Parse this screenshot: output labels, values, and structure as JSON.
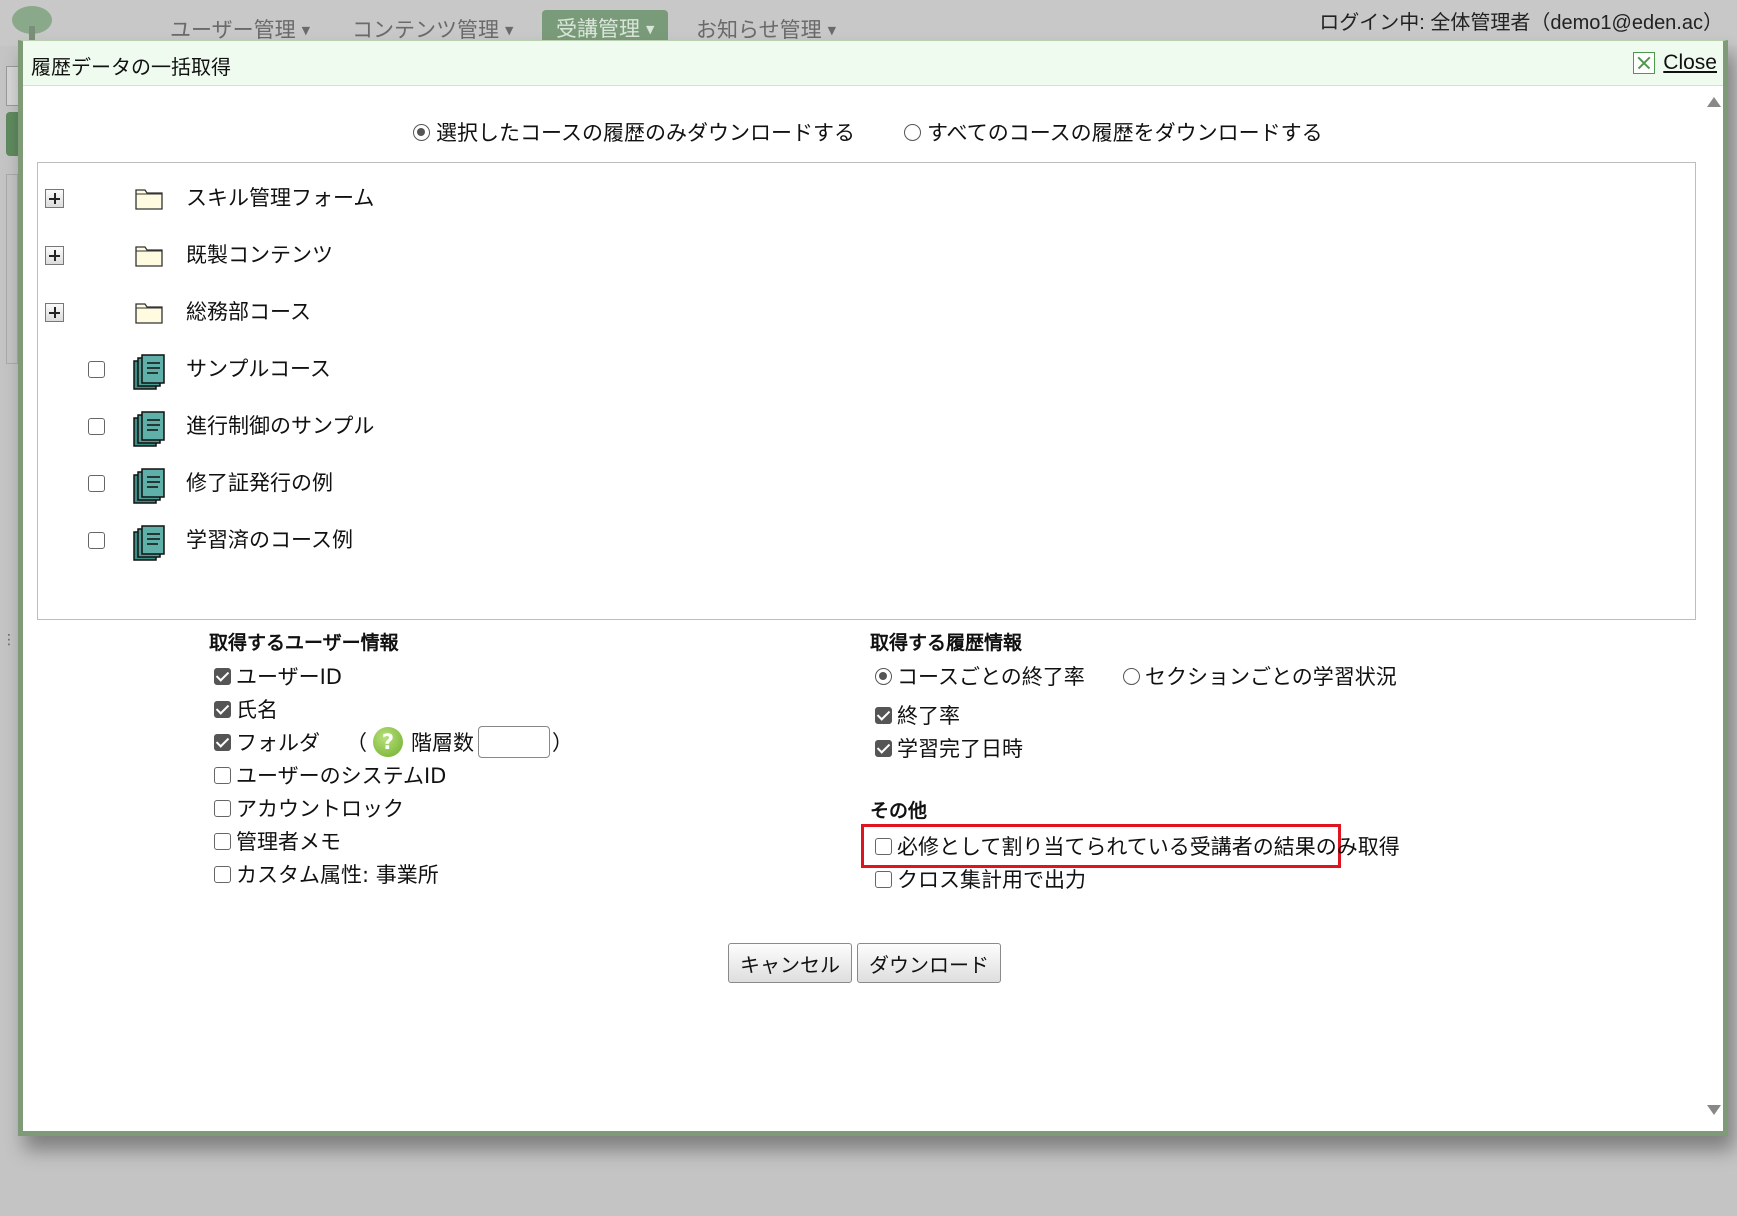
{
  "background": {
    "nav": [
      {
        "label": "ユーザー管理",
        "active": false
      },
      {
        "label": "コンテンツ管理",
        "active": false
      },
      {
        "label": "受講管理",
        "active": true
      },
      {
        "label": "お知らせ管理",
        "active": false
      }
    ],
    "login_text": "ログイン中: 全体管理者（demo1@eden.ac）"
  },
  "dialog": {
    "title": "履歴データの一括取得",
    "close_label": "Close",
    "scope_options": [
      {
        "label": "選択したコースの履歴のみダウンロードする",
        "selected": true
      },
      {
        "label": "すべてのコースの履歴をダウンロードする",
        "selected": false
      }
    ],
    "tree": [
      {
        "type": "folder",
        "label": "スキル管理フォーム"
      },
      {
        "type": "folder",
        "label": "既製コンテンツ"
      },
      {
        "type": "folder",
        "label": "総務部コース"
      },
      {
        "type": "course",
        "label": "サンプルコース",
        "checked": false
      },
      {
        "type": "course",
        "label": "進行制御のサンプル",
        "checked": false
      },
      {
        "type": "course",
        "label": "修了証発行の例",
        "checked": false
      },
      {
        "type": "course",
        "label": "学習済のコース例",
        "checked": false
      }
    ],
    "user_info": {
      "heading": "取得するユーザー情報",
      "items": [
        {
          "label": "ユーザーID",
          "checked": true
        },
        {
          "label": "氏名",
          "checked": true
        },
        {
          "label": "フォルダ",
          "checked": true
        },
        {
          "label": "ユーザーのシステムID",
          "checked": false
        },
        {
          "label": "アカウントロック",
          "checked": false
        },
        {
          "label": "管理者メモ",
          "checked": false
        },
        {
          "label": "カスタム属性: 事業所",
          "checked": false
        }
      ],
      "folder_open_paren": "（",
      "folder_help_icon": "question-icon",
      "folder_depth_label": "階層数",
      "folder_depth_value": "",
      "folder_close_paren": "）"
    },
    "history_info": {
      "heading": "取得する履歴情報",
      "mode_options": [
        {
          "label": "コースごとの終了率",
          "selected": true
        },
        {
          "label": "セクションごとの学習状況",
          "selected": false
        }
      ],
      "items": [
        {
          "label": "終了率",
          "checked": true
        },
        {
          "label": "学習完了日時",
          "checked": true
        }
      ]
    },
    "other": {
      "heading": "その他",
      "items": [
        {
          "label": "必修として割り当てられている受講者の結果のみ取得",
          "checked": false,
          "highlighted": true
        },
        {
          "label": "クロス集計用で出力",
          "checked": false
        }
      ]
    },
    "buttons": {
      "cancel": "キャンセル",
      "download": "ダウンロード"
    },
    "colors": {
      "titlebar_bg": "#effbef",
      "dialog_border": "#7f9a77",
      "highlight": "#e0141e",
      "help_icon": "#6fae2c",
      "course_icon": "#4f9e98"
    }
  }
}
